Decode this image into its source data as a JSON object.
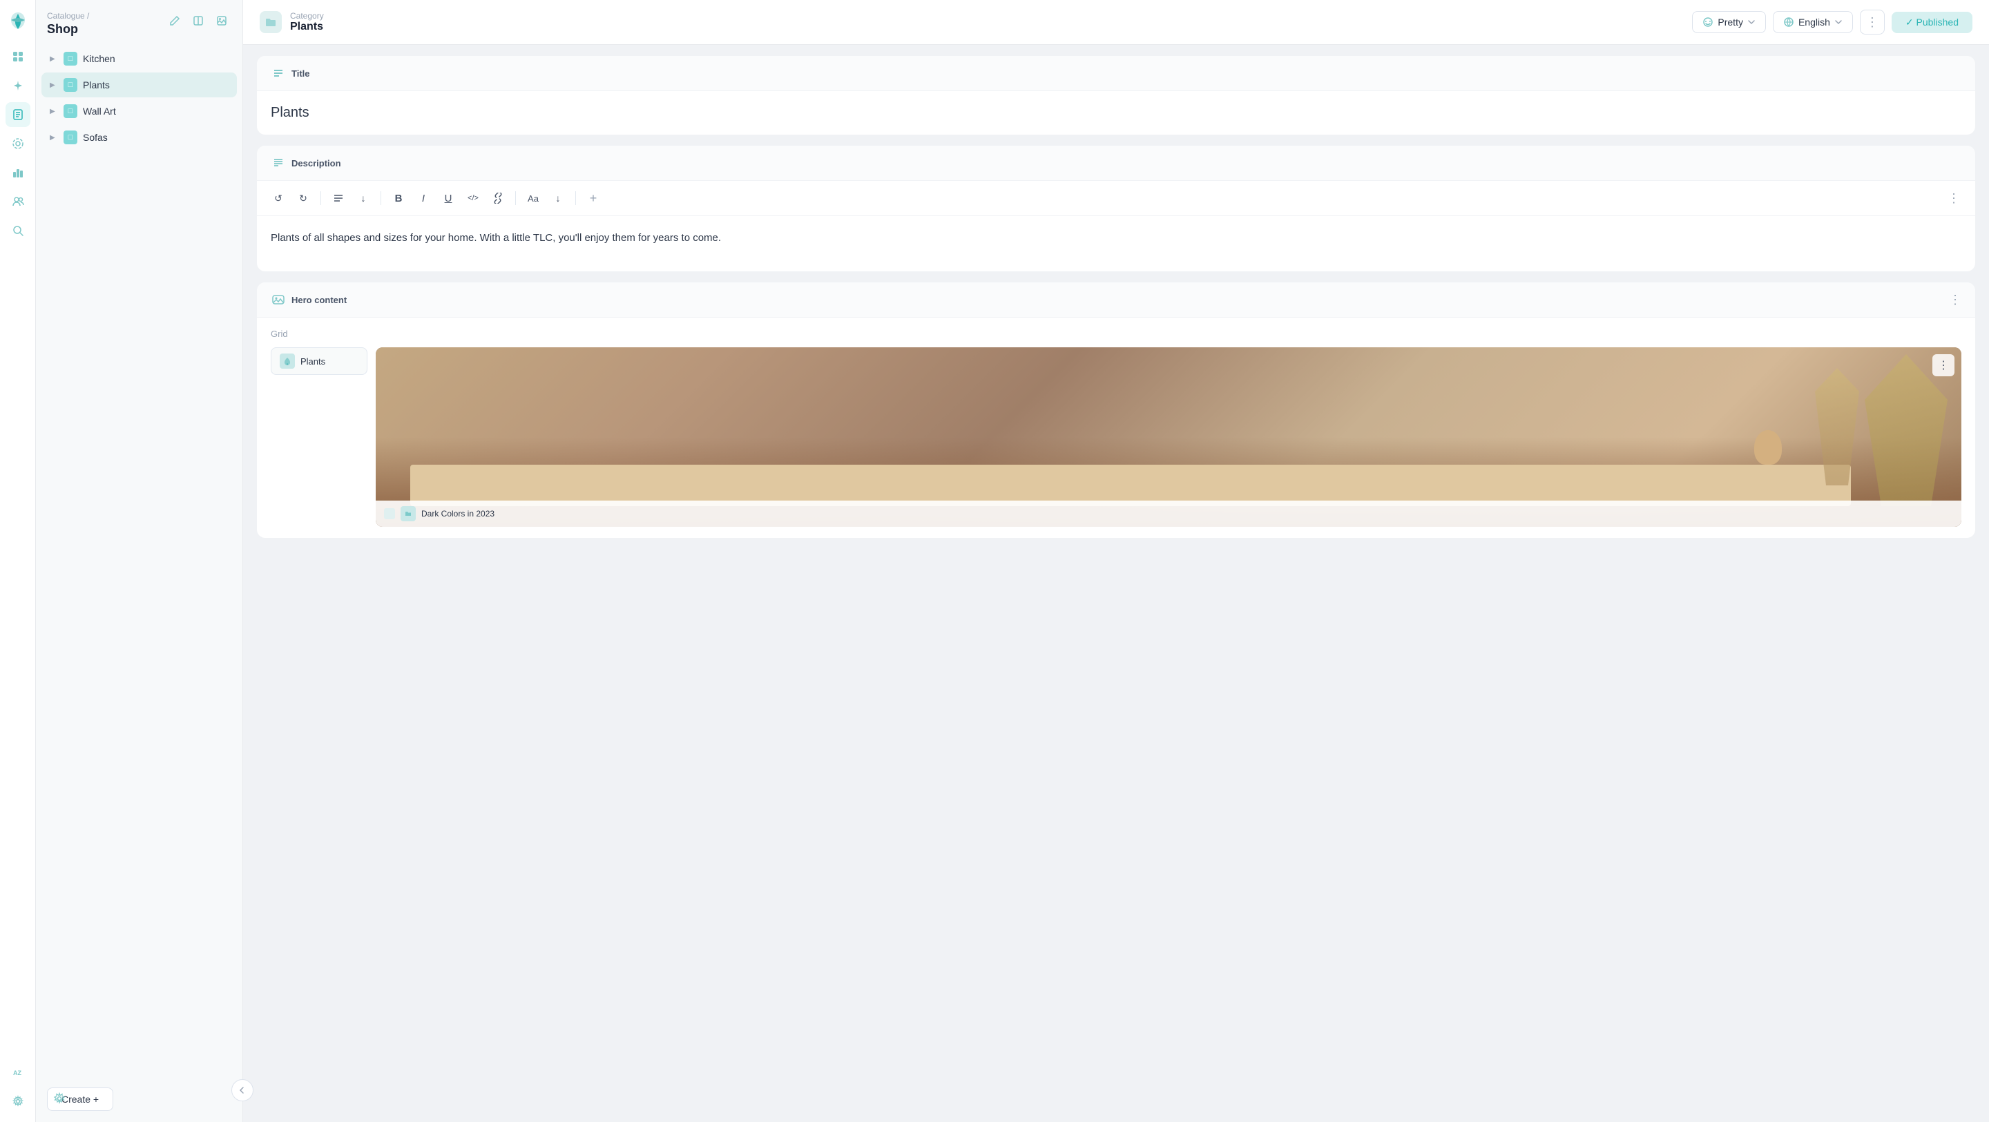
{
  "app": {
    "logo_text": "🌿"
  },
  "sidebar_icons": {
    "items": [
      {
        "name": "home-icon",
        "icon": "⊞",
        "active": false
      },
      {
        "name": "sparkle-icon",
        "icon": "✦",
        "active": false
      },
      {
        "name": "pages-icon",
        "icon": "▣",
        "active": true
      },
      {
        "name": "integrations-icon",
        "icon": "⊛",
        "active": false
      },
      {
        "name": "analytics-icon",
        "icon": "⊞",
        "active": false
      },
      {
        "name": "settings-cog-icon",
        "icon": "⚙",
        "active": false
      },
      {
        "name": "users-icon",
        "icon": "◎",
        "active": false
      },
      {
        "name": "search-icon",
        "icon": "⌕",
        "active": false
      },
      {
        "name": "az-icon",
        "icon": "AZ",
        "active": false
      }
    ]
  },
  "nav_panel": {
    "breadcrumb": "Catalogue /",
    "title": "Shop",
    "toolbar": {
      "edit_label": "✎",
      "book_label": "⊟",
      "image_label": "⊡"
    },
    "tree_items": [
      {
        "label": "Kitchen",
        "active": false
      },
      {
        "label": "Plants",
        "active": true
      },
      {
        "label": "Wall Art",
        "active": false
      },
      {
        "label": "Sofas",
        "active": false
      }
    ],
    "create_button": "Create +",
    "settings_label": "⚙"
  },
  "top_bar": {
    "category_label": "Category",
    "category_name": "Plants",
    "pretty_label": "Pretty",
    "language_label": "English",
    "more_label": "⋮",
    "published_label": "✓ Published"
  },
  "title_section": {
    "section_label": "Title",
    "content": "Plants"
  },
  "description_section": {
    "section_label": "Description",
    "toolbar": {
      "undo": "↺",
      "redo": "↻",
      "align": "≡",
      "align_down": "↓",
      "bold": "B",
      "italic": "I",
      "underline": "U",
      "code": "</>",
      "link": "🔗",
      "font": "Aa",
      "font_down": "↓",
      "add": "+",
      "more": "⋮"
    },
    "content": "Plants of all shapes and sizes for your home. With a little TLC, you'll enjoy them for years to come."
  },
  "hero_section": {
    "section_label": "Hero content",
    "more_label": "⋮",
    "grid_label": "Grid",
    "plants_card_label": "Plants",
    "image_more_label": "⋮",
    "bottom_card": {
      "label": "Dark Colors in 2023"
    }
  }
}
